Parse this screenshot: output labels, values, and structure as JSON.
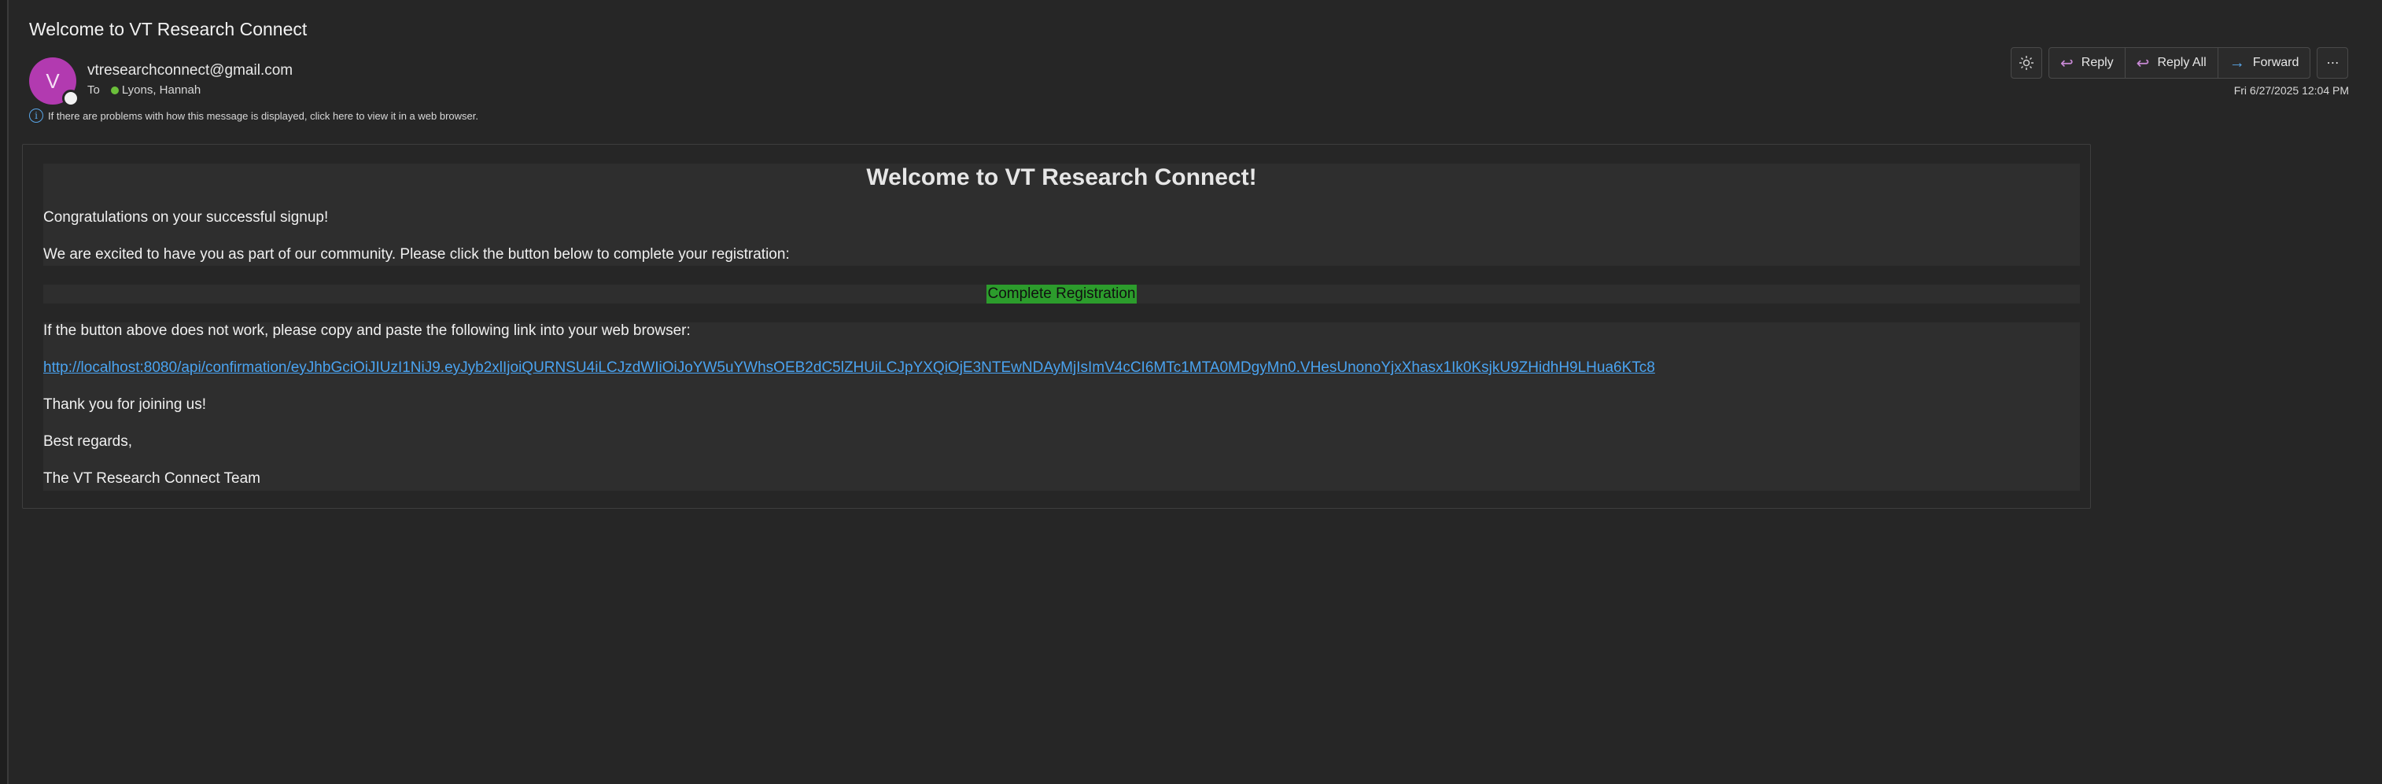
{
  "email": {
    "subject": "Welcome to VT Research Connect",
    "avatar_initial": "V",
    "sender": "vtresearchconnect@gmail.com",
    "to_label": "To",
    "recipient": "Lyons, Hannah",
    "info_message": "If there are problems with how this message is displayed, click here to view it in a web browser.",
    "date": "Fri 6/27/2025 12:04 PM"
  },
  "toolbar": {
    "reply": "Reply",
    "reply_all": "Reply All",
    "forward": "Forward",
    "more": "⋯"
  },
  "body": {
    "title": "Welcome to VT Research Connect!",
    "congrats": "Congratulations on your successful signup!",
    "intro": "We are excited to have you as part of our community. Please click the button below to complete your registration:",
    "button_label": "Complete Registration",
    "fallback_text": "If the button above does not work, please copy and paste the following link into your web browser:",
    "link": "http://localhost:8080/api/confirmation/eyJhbGciOiJIUzI1NiJ9.eyJyb2xlIjoiQURNSU4iLCJzdWIiOiJoYW5uYWhsOEB2dC5lZHUiLCJpYXQiOjE3NTEwNDAyMjIsImV4cCI6MTc1MTA0MDgyMn0.VHesUnonoYjxXhasx1Ik0KsjkU9ZHidhH9LHua6KTc8",
    "thanks": "Thank you for joining us!",
    "regards": "Best regards,",
    "signature": "The VT Research Connect Team"
  },
  "colors": {
    "background": "#262626",
    "avatar": "#b23ab0",
    "button": "#2c9c2c",
    "link": "#4aa3f0",
    "presence_available": "#6bbf3a"
  }
}
